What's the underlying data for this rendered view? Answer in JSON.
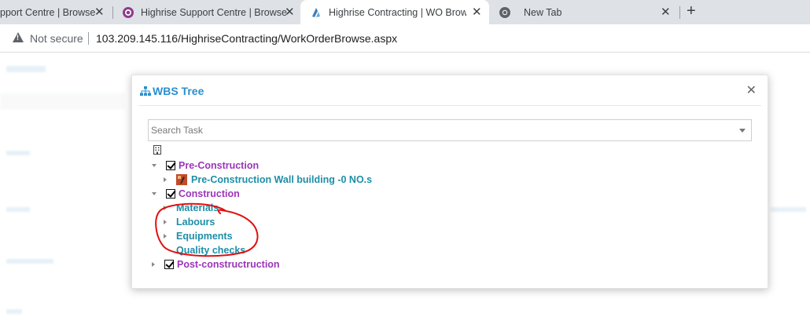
{
  "browser": {
    "tabs": [
      {
        "label": "pport Centre | Browse",
        "icon": "app-icon"
      },
      {
        "label": "Highrise Support Centre | Browse",
        "icon": "support-icon"
      },
      {
        "label": "Highrise Contracting | WO Brows",
        "icon": "highrise-icon",
        "active": true
      },
      {
        "label": "New Tab",
        "icon": "chrome-icon"
      }
    ],
    "close_glyph": "✕",
    "new_tab_glyph": "+",
    "security_label": "Not secure",
    "url": "103.209.145.116/HighriseContracting/WorkOrderBrowse.aspx"
  },
  "modal": {
    "title": "WBS Tree",
    "close_glyph": "✕",
    "search": {
      "placeholder": "Search Task",
      "value": ""
    },
    "tree": {
      "pre_construction": {
        "label": "Pre-Construction",
        "expanded": true,
        "child": {
          "label": "Pre-Construction Wall building -0 NO.s"
        }
      },
      "construction": {
        "label": "Construction",
        "expanded": true,
        "children": [
          {
            "label": "Materials"
          },
          {
            "label": "Labours"
          },
          {
            "label": "Equipments"
          },
          {
            "label": "Quality checks"
          }
        ]
      },
      "post_construction": {
        "label": "Post-constructruction",
        "expanded": false
      }
    }
  },
  "colors": {
    "title_blue": "#2a8fcf",
    "purple": "#9b35b8",
    "teal": "#1d8ea8",
    "annotation_red": "#e01010"
  }
}
